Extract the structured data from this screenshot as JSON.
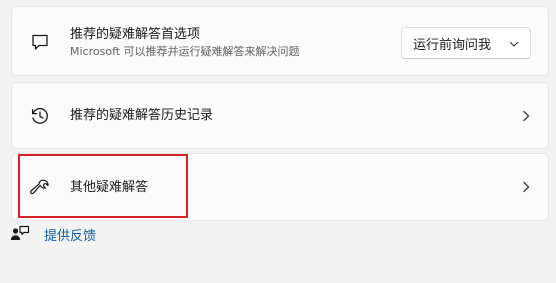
{
  "troubleshoot_preferences": {
    "title": "推荐的疑难解答首选项",
    "description": "Microsoft 可以推荐并运行疑难解答来解决问题",
    "dropdown_value": "运行前询问我",
    "icon": "chat-bubble-icon"
  },
  "history": {
    "title": "推荐的疑难解答历史记录",
    "icon": "history-icon"
  },
  "other_troubleshooters": {
    "title": "其他疑难解答",
    "icon": "wrench-icon"
  },
  "feedback": {
    "label": "提供反馈",
    "icon": "feedback-icon"
  },
  "colors": {
    "link": "#0f5ea8",
    "highlight": "#d9232b"
  }
}
